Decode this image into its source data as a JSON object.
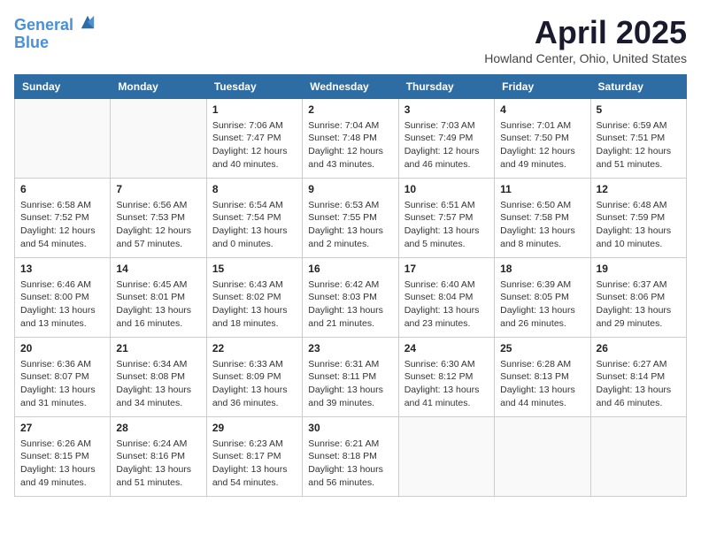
{
  "header": {
    "logo_line1": "General",
    "logo_line2": "Blue",
    "month_title": "April 2025",
    "location": "Howland Center, Ohio, United States"
  },
  "days_of_week": [
    "Sunday",
    "Monday",
    "Tuesday",
    "Wednesday",
    "Thursday",
    "Friday",
    "Saturday"
  ],
  "weeks": [
    [
      {
        "day": "",
        "detail": ""
      },
      {
        "day": "",
        "detail": ""
      },
      {
        "day": "1",
        "detail": "Sunrise: 7:06 AM\nSunset: 7:47 PM\nDaylight: 12 hours and 40 minutes."
      },
      {
        "day": "2",
        "detail": "Sunrise: 7:04 AM\nSunset: 7:48 PM\nDaylight: 12 hours and 43 minutes."
      },
      {
        "day": "3",
        "detail": "Sunrise: 7:03 AM\nSunset: 7:49 PM\nDaylight: 12 hours and 46 minutes."
      },
      {
        "day": "4",
        "detail": "Sunrise: 7:01 AM\nSunset: 7:50 PM\nDaylight: 12 hours and 49 minutes."
      },
      {
        "day": "5",
        "detail": "Sunrise: 6:59 AM\nSunset: 7:51 PM\nDaylight: 12 hours and 51 minutes."
      }
    ],
    [
      {
        "day": "6",
        "detail": "Sunrise: 6:58 AM\nSunset: 7:52 PM\nDaylight: 12 hours and 54 minutes."
      },
      {
        "day": "7",
        "detail": "Sunrise: 6:56 AM\nSunset: 7:53 PM\nDaylight: 12 hours and 57 minutes."
      },
      {
        "day": "8",
        "detail": "Sunrise: 6:54 AM\nSunset: 7:54 PM\nDaylight: 13 hours and 0 minutes."
      },
      {
        "day": "9",
        "detail": "Sunrise: 6:53 AM\nSunset: 7:55 PM\nDaylight: 13 hours and 2 minutes."
      },
      {
        "day": "10",
        "detail": "Sunrise: 6:51 AM\nSunset: 7:57 PM\nDaylight: 13 hours and 5 minutes."
      },
      {
        "day": "11",
        "detail": "Sunrise: 6:50 AM\nSunset: 7:58 PM\nDaylight: 13 hours and 8 minutes."
      },
      {
        "day": "12",
        "detail": "Sunrise: 6:48 AM\nSunset: 7:59 PM\nDaylight: 13 hours and 10 minutes."
      }
    ],
    [
      {
        "day": "13",
        "detail": "Sunrise: 6:46 AM\nSunset: 8:00 PM\nDaylight: 13 hours and 13 minutes."
      },
      {
        "day": "14",
        "detail": "Sunrise: 6:45 AM\nSunset: 8:01 PM\nDaylight: 13 hours and 16 minutes."
      },
      {
        "day": "15",
        "detail": "Sunrise: 6:43 AM\nSunset: 8:02 PM\nDaylight: 13 hours and 18 minutes."
      },
      {
        "day": "16",
        "detail": "Sunrise: 6:42 AM\nSunset: 8:03 PM\nDaylight: 13 hours and 21 minutes."
      },
      {
        "day": "17",
        "detail": "Sunrise: 6:40 AM\nSunset: 8:04 PM\nDaylight: 13 hours and 23 minutes."
      },
      {
        "day": "18",
        "detail": "Sunrise: 6:39 AM\nSunset: 8:05 PM\nDaylight: 13 hours and 26 minutes."
      },
      {
        "day": "19",
        "detail": "Sunrise: 6:37 AM\nSunset: 8:06 PM\nDaylight: 13 hours and 29 minutes."
      }
    ],
    [
      {
        "day": "20",
        "detail": "Sunrise: 6:36 AM\nSunset: 8:07 PM\nDaylight: 13 hours and 31 minutes."
      },
      {
        "day": "21",
        "detail": "Sunrise: 6:34 AM\nSunset: 8:08 PM\nDaylight: 13 hours and 34 minutes."
      },
      {
        "day": "22",
        "detail": "Sunrise: 6:33 AM\nSunset: 8:09 PM\nDaylight: 13 hours and 36 minutes."
      },
      {
        "day": "23",
        "detail": "Sunrise: 6:31 AM\nSunset: 8:11 PM\nDaylight: 13 hours and 39 minutes."
      },
      {
        "day": "24",
        "detail": "Sunrise: 6:30 AM\nSunset: 8:12 PM\nDaylight: 13 hours and 41 minutes."
      },
      {
        "day": "25",
        "detail": "Sunrise: 6:28 AM\nSunset: 8:13 PM\nDaylight: 13 hours and 44 minutes."
      },
      {
        "day": "26",
        "detail": "Sunrise: 6:27 AM\nSunset: 8:14 PM\nDaylight: 13 hours and 46 minutes."
      }
    ],
    [
      {
        "day": "27",
        "detail": "Sunrise: 6:26 AM\nSunset: 8:15 PM\nDaylight: 13 hours and 49 minutes."
      },
      {
        "day": "28",
        "detail": "Sunrise: 6:24 AM\nSunset: 8:16 PM\nDaylight: 13 hours and 51 minutes."
      },
      {
        "day": "29",
        "detail": "Sunrise: 6:23 AM\nSunset: 8:17 PM\nDaylight: 13 hours and 54 minutes."
      },
      {
        "day": "30",
        "detail": "Sunrise: 6:21 AM\nSunset: 8:18 PM\nDaylight: 13 hours and 56 minutes."
      },
      {
        "day": "",
        "detail": ""
      },
      {
        "day": "",
        "detail": ""
      },
      {
        "day": "",
        "detail": ""
      }
    ]
  ]
}
